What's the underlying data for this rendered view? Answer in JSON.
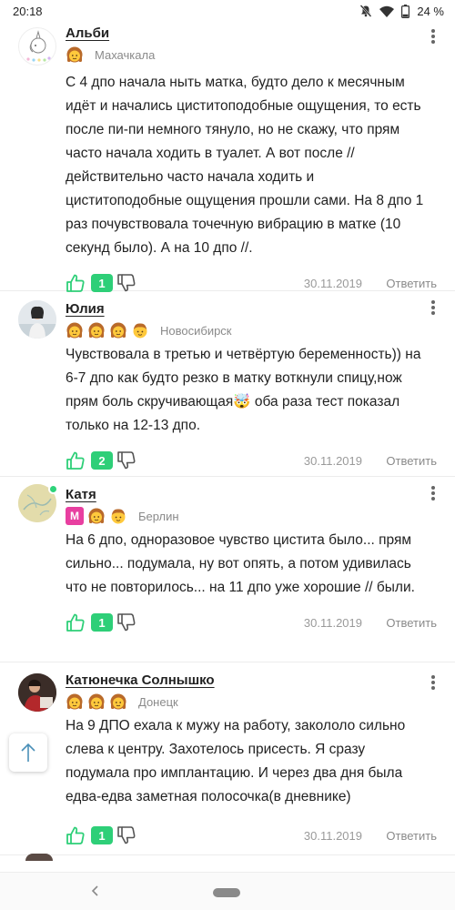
{
  "status_bar": {
    "time": "20:18",
    "battery": "24 %"
  },
  "comments": [
    {
      "author": "Альби",
      "city": "Махачкала",
      "text": "С 4 дпо начала ныть матка, будто дело к месячным идёт и начались циститоподобные ощущения, то есть после пи-пи немного тянуло, но не скажу, что прям часто начала ходить в туалет. А вот после // действительно часто начала ходить и циститоподобные ощущения прошли сами. На 8 дпо 1 раз почувствовала точечную вибрацию в матке (10 секунд было). А на 10 дпо //.",
      "likes": "1",
      "date": "30.11.2019",
      "reply": "Ответить"
    },
    {
      "author": "Юлия",
      "city": "Новосибирск",
      "text": "Чувствовала в третью и четвёртую беременность)) на 6-7 дпо как будто резко в матку воткнули спицу,нож прям боль скручивающая🤯 оба раза тест показал только на 12-13 дпо.",
      "likes": "2",
      "date": "30.11.2019",
      "reply": "Ответить"
    },
    {
      "author": "Катя",
      "badge": "М",
      "city": "Берлин",
      "text": "На 6 дпо, одноразовое чувство цистита было... прям сильно... подумала, ну вот опять, а потом удивилась что не повторилось... на 11 дпо уже хорошие // были.",
      "likes": "1",
      "date": "30.11.2019",
      "reply": "Ответить"
    },
    {
      "author": "Катюнечка Солнышко",
      "city": "Донецк",
      "text": "На 9 ДПО ехала к мужу на работу, закололо сильно слева к центру. Захотелось присесть. Я сразу подумала про имплантацию. И через два дня была едва-едва заметная полосочка(в дневнике)",
      "likes": "1",
      "date": "30.11.2019",
      "reply": "Ответить"
    }
  ],
  "colors": {
    "like_badge": "#2ecf78",
    "like_icon": "#2ecf78",
    "mom_badge": "#e83fa0",
    "online": "#2ed37a"
  },
  "icons": [
    "mute-icon",
    "wifi-icon",
    "battery-icon",
    "thumb-up-icon",
    "thumb-down-icon",
    "kebab-menu-icon",
    "girl-face-icon",
    "boy-face-icon",
    "arrow-up-icon",
    "nav-back-icon"
  ]
}
